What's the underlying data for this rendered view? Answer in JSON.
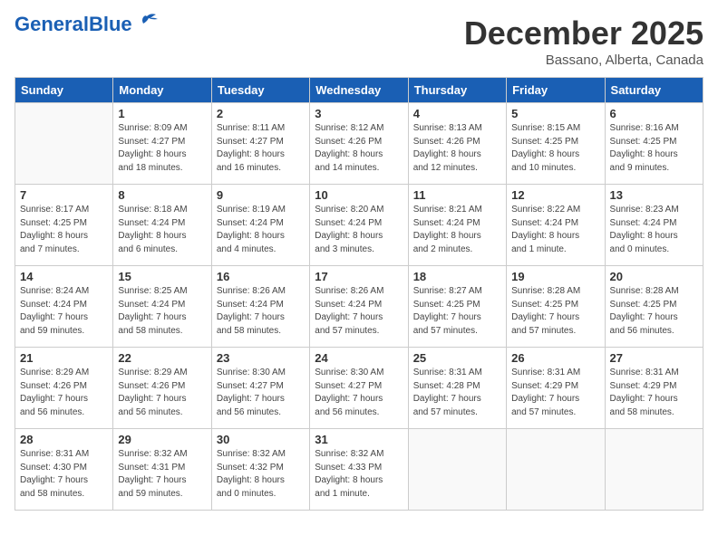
{
  "header": {
    "logo_general": "General",
    "logo_blue": "Blue",
    "month": "December 2025",
    "location": "Bassano, Alberta, Canada"
  },
  "days_of_week": [
    "Sunday",
    "Monday",
    "Tuesday",
    "Wednesday",
    "Thursday",
    "Friday",
    "Saturday"
  ],
  "weeks": [
    [
      {
        "day": "",
        "content": ""
      },
      {
        "day": "1",
        "content": "Sunrise: 8:09 AM\nSunset: 4:27 PM\nDaylight: 8 hours\nand 18 minutes."
      },
      {
        "day": "2",
        "content": "Sunrise: 8:11 AM\nSunset: 4:27 PM\nDaylight: 8 hours\nand 16 minutes."
      },
      {
        "day": "3",
        "content": "Sunrise: 8:12 AM\nSunset: 4:26 PM\nDaylight: 8 hours\nand 14 minutes."
      },
      {
        "day": "4",
        "content": "Sunrise: 8:13 AM\nSunset: 4:26 PM\nDaylight: 8 hours\nand 12 minutes."
      },
      {
        "day": "5",
        "content": "Sunrise: 8:15 AM\nSunset: 4:25 PM\nDaylight: 8 hours\nand 10 minutes."
      },
      {
        "day": "6",
        "content": "Sunrise: 8:16 AM\nSunset: 4:25 PM\nDaylight: 8 hours\nand 9 minutes."
      }
    ],
    [
      {
        "day": "7",
        "content": "Sunrise: 8:17 AM\nSunset: 4:25 PM\nDaylight: 8 hours\nand 7 minutes."
      },
      {
        "day": "8",
        "content": "Sunrise: 8:18 AM\nSunset: 4:24 PM\nDaylight: 8 hours\nand 6 minutes."
      },
      {
        "day": "9",
        "content": "Sunrise: 8:19 AM\nSunset: 4:24 PM\nDaylight: 8 hours\nand 4 minutes."
      },
      {
        "day": "10",
        "content": "Sunrise: 8:20 AM\nSunset: 4:24 PM\nDaylight: 8 hours\nand 3 minutes."
      },
      {
        "day": "11",
        "content": "Sunrise: 8:21 AM\nSunset: 4:24 PM\nDaylight: 8 hours\nand 2 minutes."
      },
      {
        "day": "12",
        "content": "Sunrise: 8:22 AM\nSunset: 4:24 PM\nDaylight: 8 hours\nand 1 minute."
      },
      {
        "day": "13",
        "content": "Sunrise: 8:23 AM\nSunset: 4:24 PM\nDaylight: 8 hours\nand 0 minutes."
      }
    ],
    [
      {
        "day": "14",
        "content": "Sunrise: 8:24 AM\nSunset: 4:24 PM\nDaylight: 7 hours\nand 59 minutes."
      },
      {
        "day": "15",
        "content": "Sunrise: 8:25 AM\nSunset: 4:24 PM\nDaylight: 7 hours\nand 58 minutes."
      },
      {
        "day": "16",
        "content": "Sunrise: 8:26 AM\nSunset: 4:24 PM\nDaylight: 7 hours\nand 58 minutes."
      },
      {
        "day": "17",
        "content": "Sunrise: 8:26 AM\nSunset: 4:24 PM\nDaylight: 7 hours\nand 57 minutes."
      },
      {
        "day": "18",
        "content": "Sunrise: 8:27 AM\nSunset: 4:25 PM\nDaylight: 7 hours\nand 57 minutes."
      },
      {
        "day": "19",
        "content": "Sunrise: 8:28 AM\nSunset: 4:25 PM\nDaylight: 7 hours\nand 57 minutes."
      },
      {
        "day": "20",
        "content": "Sunrise: 8:28 AM\nSunset: 4:25 PM\nDaylight: 7 hours\nand 56 minutes."
      }
    ],
    [
      {
        "day": "21",
        "content": "Sunrise: 8:29 AM\nSunset: 4:26 PM\nDaylight: 7 hours\nand 56 minutes."
      },
      {
        "day": "22",
        "content": "Sunrise: 8:29 AM\nSunset: 4:26 PM\nDaylight: 7 hours\nand 56 minutes."
      },
      {
        "day": "23",
        "content": "Sunrise: 8:30 AM\nSunset: 4:27 PM\nDaylight: 7 hours\nand 56 minutes."
      },
      {
        "day": "24",
        "content": "Sunrise: 8:30 AM\nSunset: 4:27 PM\nDaylight: 7 hours\nand 56 minutes."
      },
      {
        "day": "25",
        "content": "Sunrise: 8:31 AM\nSunset: 4:28 PM\nDaylight: 7 hours\nand 57 minutes."
      },
      {
        "day": "26",
        "content": "Sunrise: 8:31 AM\nSunset: 4:29 PM\nDaylight: 7 hours\nand 57 minutes."
      },
      {
        "day": "27",
        "content": "Sunrise: 8:31 AM\nSunset: 4:29 PM\nDaylight: 7 hours\nand 58 minutes."
      }
    ],
    [
      {
        "day": "28",
        "content": "Sunrise: 8:31 AM\nSunset: 4:30 PM\nDaylight: 7 hours\nand 58 minutes."
      },
      {
        "day": "29",
        "content": "Sunrise: 8:32 AM\nSunset: 4:31 PM\nDaylight: 7 hours\nand 59 minutes."
      },
      {
        "day": "30",
        "content": "Sunrise: 8:32 AM\nSunset: 4:32 PM\nDaylight: 8 hours\nand 0 minutes."
      },
      {
        "day": "31",
        "content": "Sunrise: 8:32 AM\nSunset: 4:33 PM\nDaylight: 8 hours\nand 1 minute."
      },
      {
        "day": "",
        "content": ""
      },
      {
        "day": "",
        "content": ""
      },
      {
        "day": "",
        "content": ""
      }
    ]
  ]
}
